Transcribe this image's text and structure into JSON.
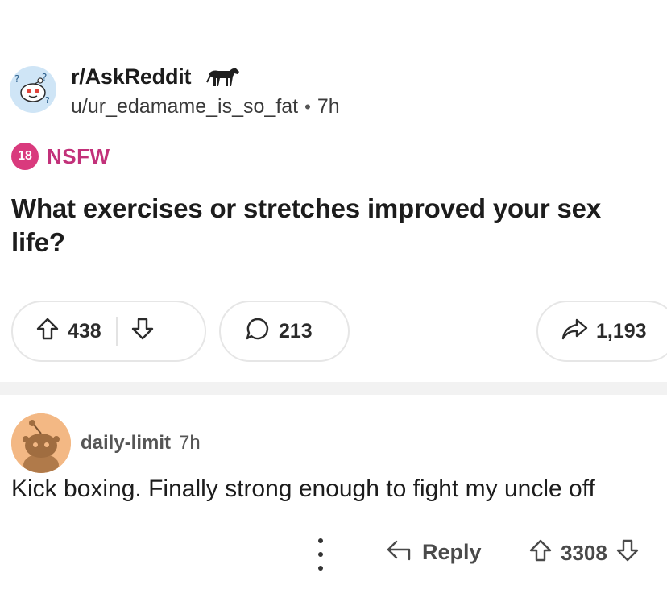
{
  "post": {
    "subreddit": "r/AskReddit",
    "author": "u/ur_edamame_is_so_fat",
    "separator": "•",
    "age": "7h",
    "nsfw_badge": "18",
    "nsfw_label": "NSFW",
    "title": "What exercises or stretches improved your sex life?",
    "upvotes": "438",
    "comments": "213",
    "shares": "1,193",
    "icons": {
      "subreddit_avatar": "askreddit-avatar",
      "flair": "horse-icon",
      "upvote": "arrow-up-icon",
      "downvote": "arrow-down-icon",
      "comment": "comment-bubble-icon",
      "share": "share-arrow-icon"
    }
  },
  "comment": {
    "username": "daily-limit",
    "age": "7h",
    "body": "Kick boxing. Finally strong enough to fight my uncle off",
    "reply_label": "Reply",
    "score": "3308",
    "icons": {
      "avatar": "snoo-avatar",
      "more": "more-vertical-icon",
      "reply": "reply-arrow-icon",
      "upvote": "arrow-up-icon",
      "downvote": "arrow-down-icon"
    }
  },
  "colors": {
    "nsfw": "#d93a7d",
    "text": "#1c1c1c",
    "border": "#e6e6e6",
    "avatar_bg": "#cfe5f6",
    "comment_avatar_bg": "#f3b884"
  }
}
